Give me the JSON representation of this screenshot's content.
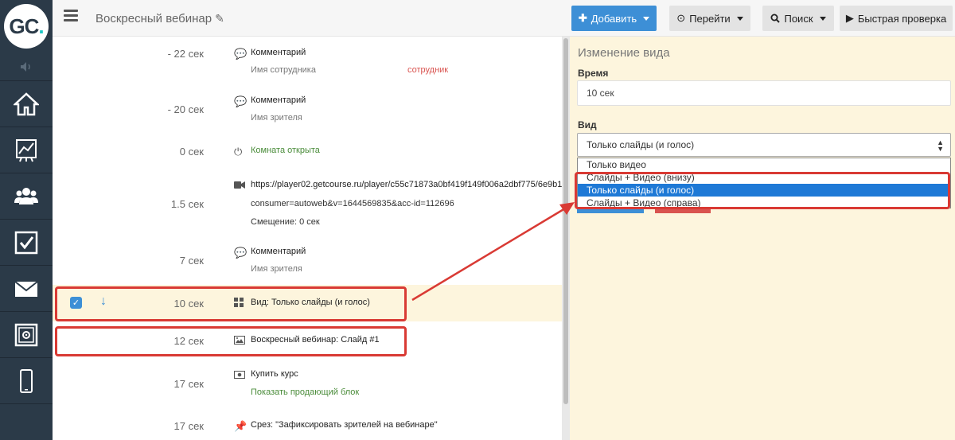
{
  "app": {
    "logo_text": "GC",
    "logo_dot": "."
  },
  "header": {
    "title": "Воскресный вебинар",
    "buttons": {
      "add": "Добавить",
      "goto": "Перейти",
      "search": "Поиск",
      "quick_check": "Быстрая проверка"
    }
  },
  "sidebar": {
    "items": [
      {
        "icon": "home-icon"
      },
      {
        "icon": "chart-icon"
      },
      {
        "icon": "users-icon"
      },
      {
        "icon": "checkbox-icon"
      },
      {
        "icon": "mail-icon"
      },
      {
        "icon": "safe-icon"
      },
      {
        "icon": "phone-icon"
      }
    ]
  },
  "timeline": [
    {
      "time": "- 22 сек",
      "icon": "comment-icon",
      "line1": "Комментарий",
      "line2": "Имя сотрудника",
      "tag": "сотрудник"
    },
    {
      "time": "- 20 сек",
      "icon": "comment-icon",
      "line1": "Комментарий",
      "line2": "Имя зрителя"
    },
    {
      "time": "0 сек",
      "icon": "power-icon",
      "line1": "Комната открыта"
    },
    {
      "time": "1.5 сек",
      "icon": "video-icon",
      "line1": "https://player02.getcourse.ru/player/c55c71873a0bf419f149f006a2dbf775/6e9b1",
      "line2": "consumer=autoweb&v=1644569835&acc-id=112696",
      "line3": "Смещение: 0 сек"
    },
    {
      "time": "7 сек",
      "icon": "comment-icon",
      "line1": "Комментарий",
      "line2": "Имя зрителя"
    },
    {
      "time": "10 сек",
      "icon": "grid-icon",
      "line1": "Вид: Только слайды (и голос)"
    },
    {
      "time": "12 сек",
      "icon": "image-icon",
      "line1": "Воскресный вебинар: Слайд #1"
    },
    {
      "time": "17 сек",
      "icon": "money-icon",
      "line1": "Купить курс",
      "line2": "Показать продающий блок"
    },
    {
      "time": "17 сек",
      "icon": "pin-icon",
      "line1": "Срез: \"Зафиксировать зрителей на вебинаре\""
    }
  ],
  "panel": {
    "title": "Изменение вида",
    "time_label": "Время",
    "time_value": "10 сек",
    "view_label": "Вид",
    "view_selected": "Только слайды (и голос)",
    "options": [
      "Только видео",
      "Слайды + Видео (внизу)",
      "Только слайды (и голос)",
      "Слайды + Видео (справа)"
    ]
  },
  "colors": {
    "sidebar": "#2b3a48",
    "primary": "#3d8fd6",
    "highlight": "#fdf5dd",
    "annotation": "#d93a34",
    "option_selected": "#1e79d6"
  }
}
